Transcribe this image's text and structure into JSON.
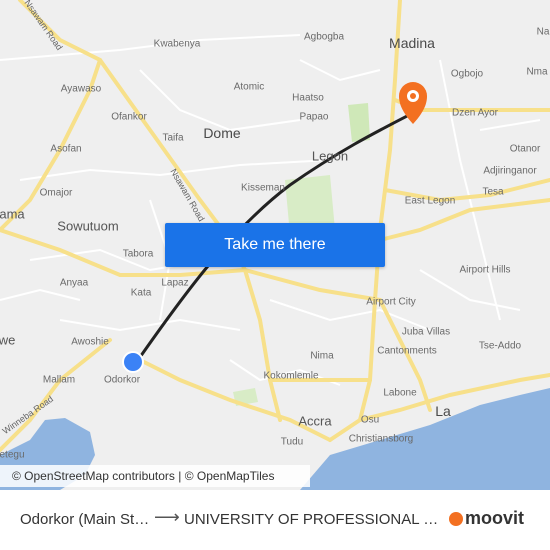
{
  "map": {
    "places": [
      {
        "id": "kwabenya",
        "label": "Kwabenya"
      },
      {
        "id": "agbogba",
        "label": "Agbogba"
      },
      {
        "id": "madina",
        "label": "Madina"
      },
      {
        "id": "ayawaso",
        "label": "Ayawaso"
      },
      {
        "id": "atomic",
        "label": "Atomic"
      },
      {
        "id": "ogbojo",
        "label": "Ogbojo"
      },
      {
        "id": "haatso",
        "label": "Haatso"
      },
      {
        "id": "ofankor",
        "label": "Ofankor"
      },
      {
        "id": "papao",
        "label": "Papao"
      },
      {
        "id": "dzen-ayor",
        "label": "Dzen Ayor"
      },
      {
        "id": "taifa",
        "label": "Taifa"
      },
      {
        "id": "dome",
        "label": "Dome"
      },
      {
        "id": "asofan",
        "label": "Asofan"
      },
      {
        "id": "legon",
        "label": "Legon"
      },
      {
        "id": "otanor",
        "label": "Otanor"
      },
      {
        "id": "adjiringanor",
        "label": "Adjiringanor"
      },
      {
        "id": "omajor",
        "label": "Omajor"
      },
      {
        "id": "kisseman",
        "label": "Kisseman"
      },
      {
        "id": "tesa",
        "label": "Tesa"
      },
      {
        "id": "ama",
        "label": "ama"
      },
      {
        "id": "sowutuom",
        "label": "Sowutuom"
      },
      {
        "id": "east-legon",
        "label": "East Legon"
      },
      {
        "id": "tabora",
        "label": "Tabora"
      },
      {
        "id": "anyaa",
        "label": "Anyaa"
      },
      {
        "id": "airport-hills",
        "label": "Airport Hills"
      },
      {
        "id": "kata",
        "label": "Kata"
      },
      {
        "id": "lapaz",
        "label": "Lapaz"
      },
      {
        "id": "airport-city",
        "label": "Airport City"
      },
      {
        "id": "awoshie",
        "label": "Awoshie"
      },
      {
        "id": "juba-villas",
        "label": "Juba Villas"
      },
      {
        "id": "we",
        "label": "we"
      },
      {
        "id": "tse-addo",
        "label": "Tse-Addo"
      },
      {
        "id": "cantonments",
        "label": "Cantonments"
      },
      {
        "id": "nima",
        "label": "Nima"
      },
      {
        "id": "mallam",
        "label": "Mallam"
      },
      {
        "id": "odorkor",
        "label": "Odorkor"
      },
      {
        "id": "kokomlemle",
        "label": "Kokomlemle"
      },
      {
        "id": "labone",
        "label": "Labone"
      },
      {
        "id": "accra",
        "label": "Accra"
      },
      {
        "id": "osu",
        "label": "Osu"
      },
      {
        "id": "la",
        "label": "La"
      },
      {
        "id": "tudu",
        "label": "Tudu"
      },
      {
        "id": "christiansborg",
        "label": "Christiansborg"
      },
      {
        "id": "etegu",
        "label": "etegu"
      },
      {
        "id": "nma",
        "label": "Nma"
      },
      {
        "id": "na",
        "label": "Na"
      }
    ],
    "roads": [
      {
        "id": "nsawam-road-top",
        "label": "Nsawam Road"
      },
      {
        "id": "nsawam-road-mid",
        "label": "Nsawam Road"
      },
      {
        "id": "winneba-road",
        "label": "Winneba Road"
      }
    ],
    "cta_label": "Take me there",
    "attribution": "© OpenStreetMap contributors | © OpenMapTiles",
    "colors": {
      "land": "#efefef",
      "water": "#8fb4e0",
      "road_major": "#f7e08a",
      "road_minor": "#ffffff",
      "park": "#cfe8b8",
      "route": "#222222",
      "origin": "#3b82f6",
      "destination": "#f37021",
      "button": "#1a73e8"
    }
  },
  "footer": {
    "from": "Odorkor (Main Station)",
    "arrow": "⟶",
    "to": "UNIVERSITY OF PROFESSIONAL STUDIES",
    "logo": "moovit"
  }
}
